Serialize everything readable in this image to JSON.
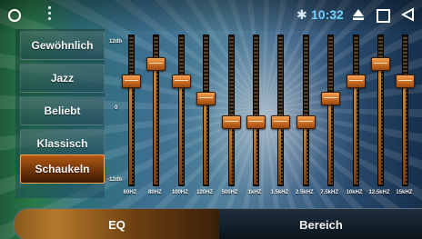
{
  "status_bar": {
    "time": "10:32",
    "icons": [
      "circle-icon",
      "menu-dots-icon",
      "bluetooth-icon",
      "eject-icon",
      "square-icon",
      "back-triangle-icon"
    ]
  },
  "presets": {
    "items": [
      "Gewöhnlich",
      "Jazz",
      "Beliebt",
      "Klassisch",
      "Schaukeln"
    ],
    "selected": "Schaukeln"
  },
  "equalizer": {
    "scale": {
      "max_label": "12db",
      "mid_label": "0",
      "min_label": "-12db",
      "min_db": -12,
      "max_db": 12
    },
    "bands": [
      {
        "label": "60HZ",
        "value_db": 5
      },
      {
        "label": "80HZ",
        "value_db": 8
      },
      {
        "label": "100HZ",
        "value_db": 5
      },
      {
        "label": "120HZ",
        "value_db": 2
      },
      {
        "label": "500HZ",
        "value_db": -2
      },
      {
        "label": "1kHZ",
        "value_db": -2
      },
      {
        "label": "1.5kHZ",
        "value_db": -2
      },
      {
        "label": "2.5kHZ",
        "value_db": -2
      },
      {
        "label": "7.5kHZ",
        "value_db": 2
      },
      {
        "label": "10kHZ",
        "value_db": 5
      },
      {
        "label": "12.5kHZ",
        "value_db": 8
      },
      {
        "label": "15kHZ",
        "value_db": 5
      }
    ]
  },
  "bottom_tabs": {
    "eq": "EQ",
    "range": "Bereich",
    "active": "EQ"
  },
  "colors": {
    "accent_orange": "#d9782a",
    "time_blue": "#6fd1ff"
  }
}
